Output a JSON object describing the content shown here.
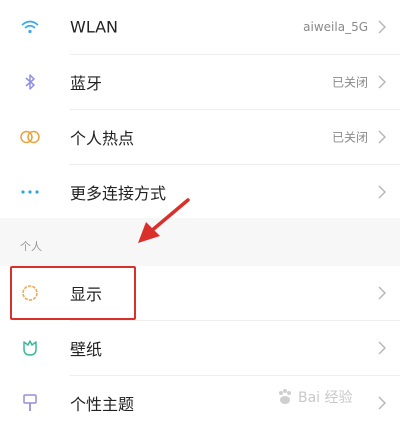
{
  "settings": {
    "wlan": {
      "label": "WLAN",
      "value": "aiweila_5G"
    },
    "bluetooth": {
      "label": "蓝牙",
      "value": "已关闭"
    },
    "hotspot": {
      "label": "个人热点",
      "value": "已关闭"
    },
    "more": {
      "label": "更多连接方式"
    },
    "section": "个人",
    "display": {
      "label": "显示"
    },
    "wallpaper": {
      "label": "壁纸"
    },
    "theme": {
      "label": "个性主题"
    }
  },
  "watermark": {
    "text": "Bai 经验"
  },
  "colors": {
    "accent_red": "#d9302c",
    "wlan_icon": "#3aa6f0",
    "bluetooth_icon": "#8f8fe6",
    "hotspot_icon": "#e8a23c",
    "more_icon": "#2ba8d8",
    "display_icon": "#f0a65a",
    "wallpaper_icon": "#3bb89a",
    "theme_icon": "#9a8fd6"
  }
}
